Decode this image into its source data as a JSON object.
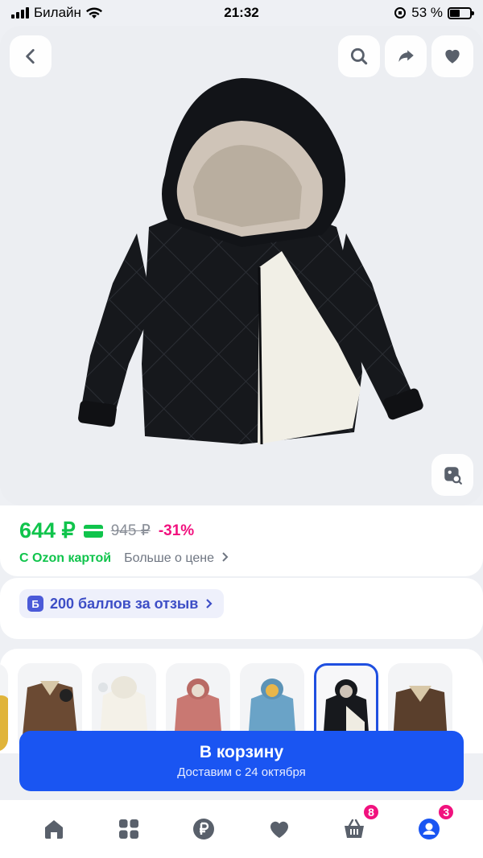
{
  "status_bar": {
    "carrier": "Билайн",
    "time": "21:32",
    "battery": "53 %"
  },
  "header": {
    "back_icon": "chevron-left-icon",
    "search_icon": "search-icon",
    "share_icon": "share-arrow-icon",
    "favorite_icon": "heart-icon",
    "visual_search_icon": "image-search-icon"
  },
  "price": {
    "current": "644 ₽",
    "old": "945 ₽",
    "discount": "-31%",
    "ozon_card_label": "С Ozon картой",
    "more_label": "Больше о цене"
  },
  "bonus": {
    "badge": "Б",
    "label": "200 баллов за отзыв"
  },
  "variants": {
    "items": [
      "yellow",
      "brown",
      "white",
      "pink",
      "blue",
      "black",
      "brown-2"
    ],
    "selected_index": 5
  },
  "cart": {
    "button_label": "В корзину",
    "delivery": "Доставим с 24 октября"
  },
  "bottom_nav": {
    "items": [
      {
        "name": "home-icon"
      },
      {
        "name": "catalog-icon"
      },
      {
        "name": "ruble-icon"
      },
      {
        "name": "favorites-icon"
      },
      {
        "name": "cart-icon",
        "badge": "8"
      },
      {
        "name": "profile-icon",
        "badge": "3"
      }
    ],
    "accent": "#1a55f2",
    "badge_color": "#f1117e"
  }
}
